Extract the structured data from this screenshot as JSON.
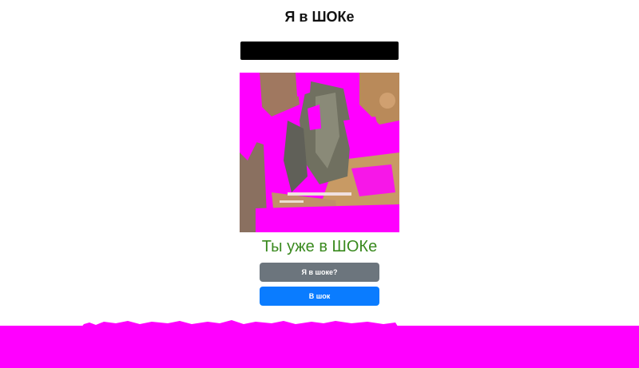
{
  "header": {
    "title": "Я в ШОКе"
  },
  "status": {
    "text": "Ты уже в ШОКе"
  },
  "buttons": {
    "shock_question_label": "Я в шоке?",
    "into_shock_label": "В шок"
  },
  "colors": {
    "accent_primary": "#0a7cff",
    "accent_secondary": "#6c757d",
    "status_green": "#3a8a1f",
    "magenta": "#ff00ff"
  }
}
